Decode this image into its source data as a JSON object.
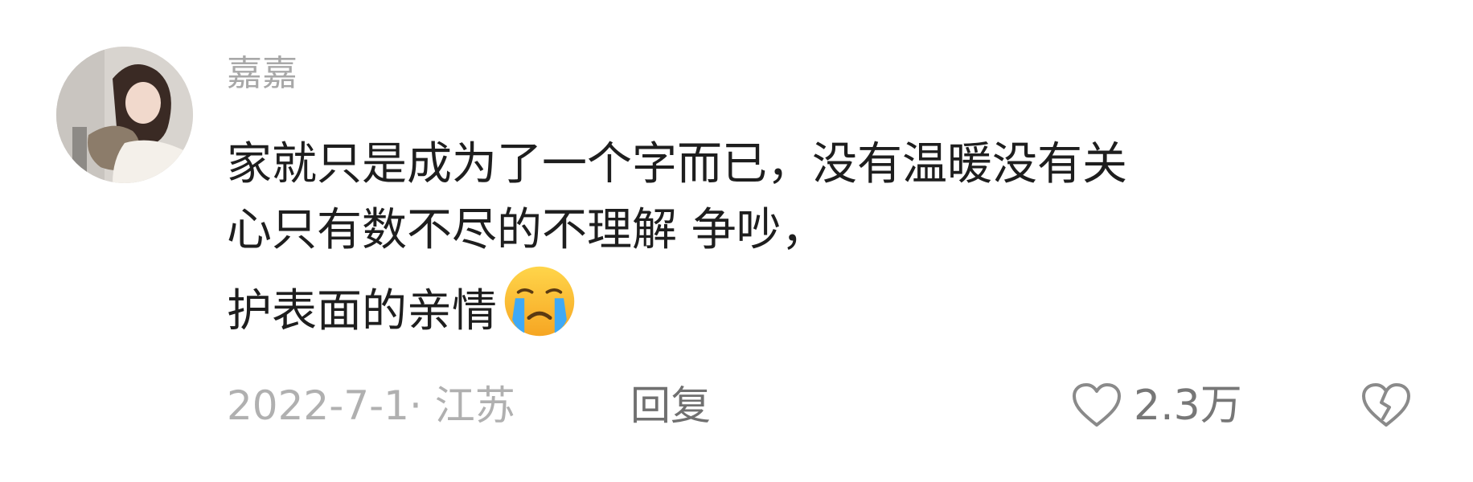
{
  "comment": {
    "username": "嘉嘉",
    "text_lines": [
      "家就只是成为了一个字而已，没有温暖没有关",
      "心只有数不尽的不理解 争吵，",
      "护表面的亲情"
    ],
    "emoji": "crying-face-icon",
    "date_location": "2022-7-1· 江苏",
    "reply_label": "回复",
    "like_count": "2.3万"
  },
  "icons": {
    "like": "heart-outline-icon",
    "dislike": "broken-heart-outline-icon"
  },
  "colors": {
    "username": "#a8a8a8",
    "text": "#1e1e1e",
    "meta": "#b0b0b0",
    "reply": "#707070",
    "icon": "#8a8a8a"
  }
}
